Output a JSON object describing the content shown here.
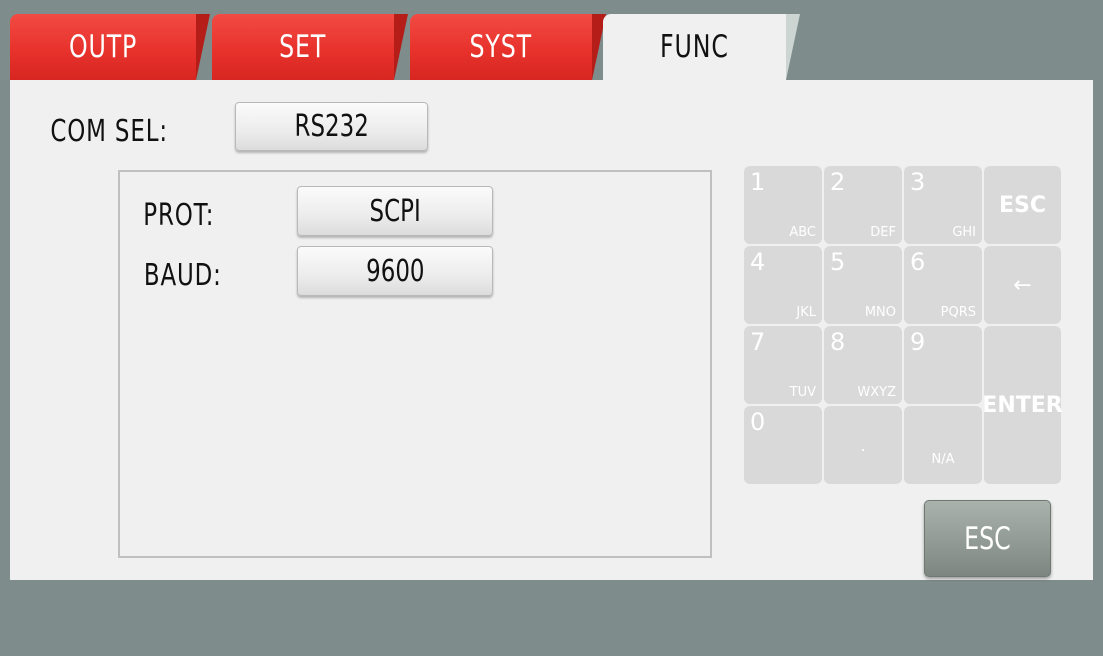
{
  "tabs": [
    {
      "label": "OUTP"
    },
    {
      "label": "SET"
    },
    {
      "label": "SYST"
    },
    {
      "label": "FUNC"
    }
  ],
  "com_sel": {
    "label": "COM SEL:",
    "value": "RS232"
  },
  "prot": {
    "label": "PROT:",
    "value": "SCPI"
  },
  "baud": {
    "label": "BAUD:",
    "value": "9600"
  },
  "keypad": {
    "keys": [
      {
        "num": "1",
        "sub": "ABC"
      },
      {
        "num": "2",
        "sub": "DEF"
      },
      {
        "num": "3",
        "sub": "GHI"
      },
      {
        "label": "ESC"
      },
      {
        "num": "4",
        "sub": "JKL"
      },
      {
        "num": "5",
        "sub": "MNO"
      },
      {
        "num": "6",
        "sub": "PQRS"
      },
      {
        "label": "←"
      },
      {
        "num": "7",
        "sub": "TUV"
      },
      {
        "num": "8",
        "sub": "WXYZ"
      },
      {
        "num": "9",
        "sub": ""
      },
      {
        "label": "ENTER"
      },
      {
        "num": "0",
        "sub": ""
      },
      {
        "label": "."
      },
      {
        "label": "N/A"
      }
    ]
  },
  "esc_button": {
    "label": "ESC"
  }
}
